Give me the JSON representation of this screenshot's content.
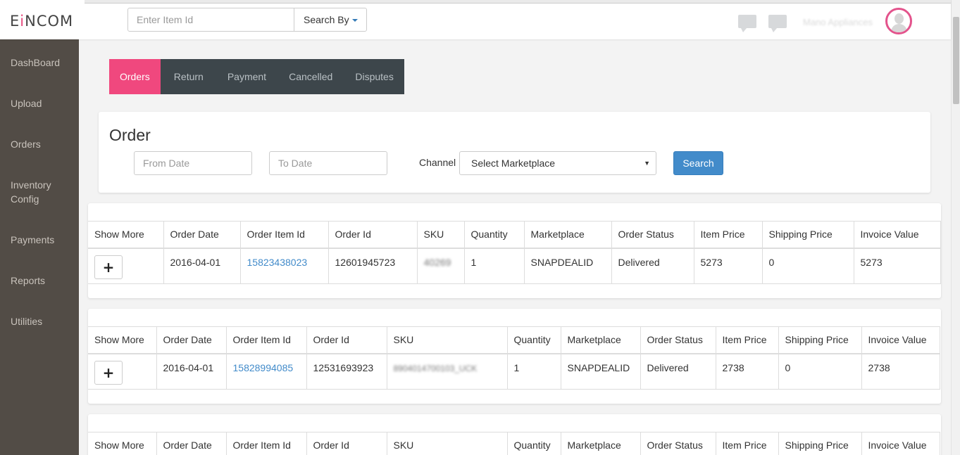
{
  "logo": {
    "prefix": "E",
    "accent": "i",
    "rest": "NCOM"
  },
  "header": {
    "search_placeholder": "Enter Item Id",
    "search_by_label": "Search By",
    "username": "Mano Appliances"
  },
  "sidebar": {
    "items": [
      {
        "label": "DashBoard"
      },
      {
        "label": "Upload"
      },
      {
        "label": "Orders"
      },
      {
        "label": "Inventory\nConfig"
      },
      {
        "label": "Payments"
      },
      {
        "label": "Reports"
      },
      {
        "label": "Utilities"
      }
    ]
  },
  "tabs": [
    {
      "label": "Orders",
      "active": true
    },
    {
      "label": "Return"
    },
    {
      "label": "Payment"
    },
    {
      "label": "Cancelled"
    },
    {
      "label": "Disputes"
    }
  ],
  "filter": {
    "title": "Order",
    "from_placeholder": "From Date",
    "to_placeholder": "To Date",
    "channel_label": "Channel",
    "marketplace_selected": "Select Marketplace",
    "search_label": "Search"
  },
  "table_headers": [
    "Show More",
    "Order Date",
    "Order Item Id",
    "Order Id",
    "SKU",
    "Quantity",
    "Marketplace",
    "Order Status",
    "Item Price",
    "Shipping Price",
    "Invoice Value"
  ],
  "orders": [
    {
      "order_date": "2016-04-01",
      "order_item_id": "15823438023",
      "order_id": "12601945723",
      "sku": "40269",
      "quantity": "1",
      "marketplace": "SNAPDEALID",
      "order_status": "Delivered",
      "item_price": "5273",
      "shipping_price": "0",
      "invoice_value": "5273"
    },
    {
      "order_date": "2016-04-01",
      "order_item_id": "15828994085",
      "order_id": "12531693923",
      "sku": "8904014700103_UCK",
      "quantity": "1",
      "marketplace": "SNAPDEALID",
      "order_status": "Delivered",
      "item_price": "2738",
      "shipping_price": "0",
      "invoice_value": "2738"
    }
  ],
  "show_more_symbol": "+",
  "colors": {
    "sidebar_bg": "#524c46",
    "tab_bar_bg": "#3d464b",
    "active_tab": "#f0487e",
    "primary_button": "#428bca",
    "link": "#428bca",
    "avatar_ring": "#e3538c"
  }
}
